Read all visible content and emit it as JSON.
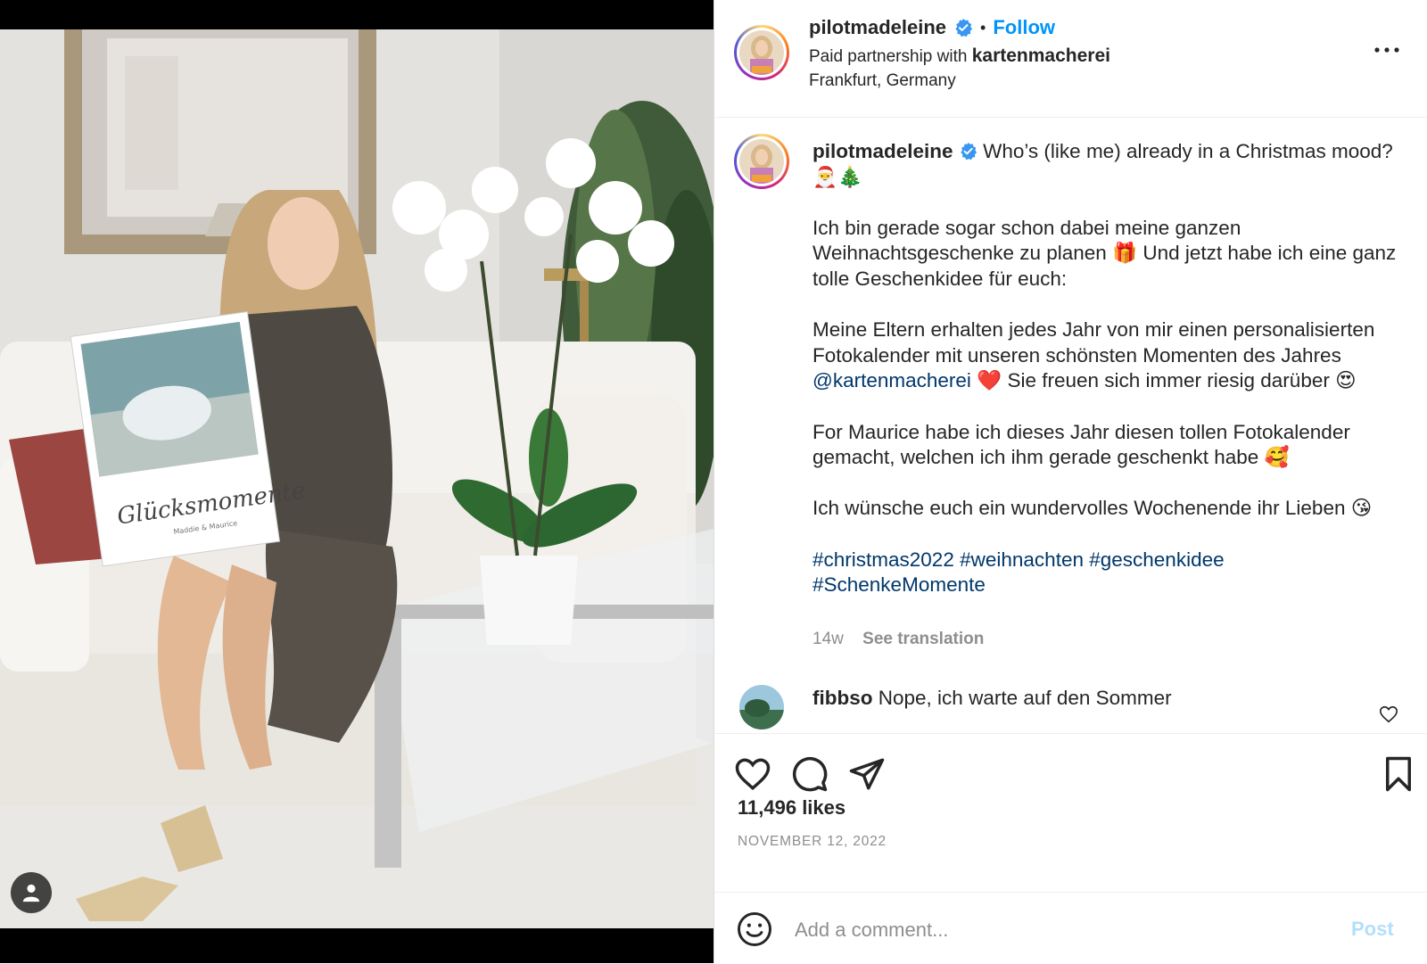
{
  "header": {
    "username": "pilotmadeleine",
    "separator": "•",
    "follow_label": "Follow",
    "partnership_prefix": "Paid partnership with ",
    "partner": "kartenmacherei",
    "location": "Frankfurt, Germany"
  },
  "caption": {
    "username": "pilotmadeleine",
    "line1": "Who’s (like me) already in a Christmas mood? 🎅🎄",
    "para1": "Ich bin gerade sogar schon dabei meine ganzen Weihnachtsgeschenke zu planen 🎁 Und jetzt habe ich eine ganz tolle Geschenkidee für euch:",
    "para2_before": "Meine Eltern erhalten jedes Jahr von mir einen personalisierten Fotokalender mit unseren schönsten Momenten des Jahres ",
    "para2_mention": "@kartenmacherei",
    "para2_after": " ❤️ Sie freuen sich immer riesig darüber 😍",
    "para3": "For Maurice habe ich dieses Jahr diesen tollen Fotokalender gemacht, welchen ich ihm gerade geschenkt habe 🥰",
    "para4": "Ich wünsche euch ein wundervolles Wochenende ihr Lieben 😘",
    "hashtags": [
      "#christmas2022",
      "#weihnachten",
      "#geschenkidee",
      "#SchenkeMomente"
    ],
    "age": "14w",
    "see_translation": "See translation"
  },
  "comment": {
    "username": "fibbso",
    "text": "Nope, ich warte auf den Sommer"
  },
  "photo": {
    "calendar_title": "Glücksmomente",
    "calendar_subtitle": "Maddie & Maurice"
  },
  "icons": {
    "like": "heart-icon",
    "comment": "comment-bubble-icon",
    "share": "paper-plane-icon",
    "save": "bookmark-icon",
    "emoji": "smiley-icon",
    "more": "ellipsis-icon",
    "verified": "verified-badge-icon",
    "user_tag": "person-icon"
  },
  "stats": {
    "likes": "11,496 likes",
    "date": "NOVEMBER 12, 2022"
  },
  "comment_input": {
    "placeholder": "Add a comment...",
    "post_label": "Post"
  },
  "colors": {
    "follow": "#0095f6",
    "link": "#00376b",
    "post_disabled": "#b2dffc",
    "verified": "#3897f0"
  }
}
